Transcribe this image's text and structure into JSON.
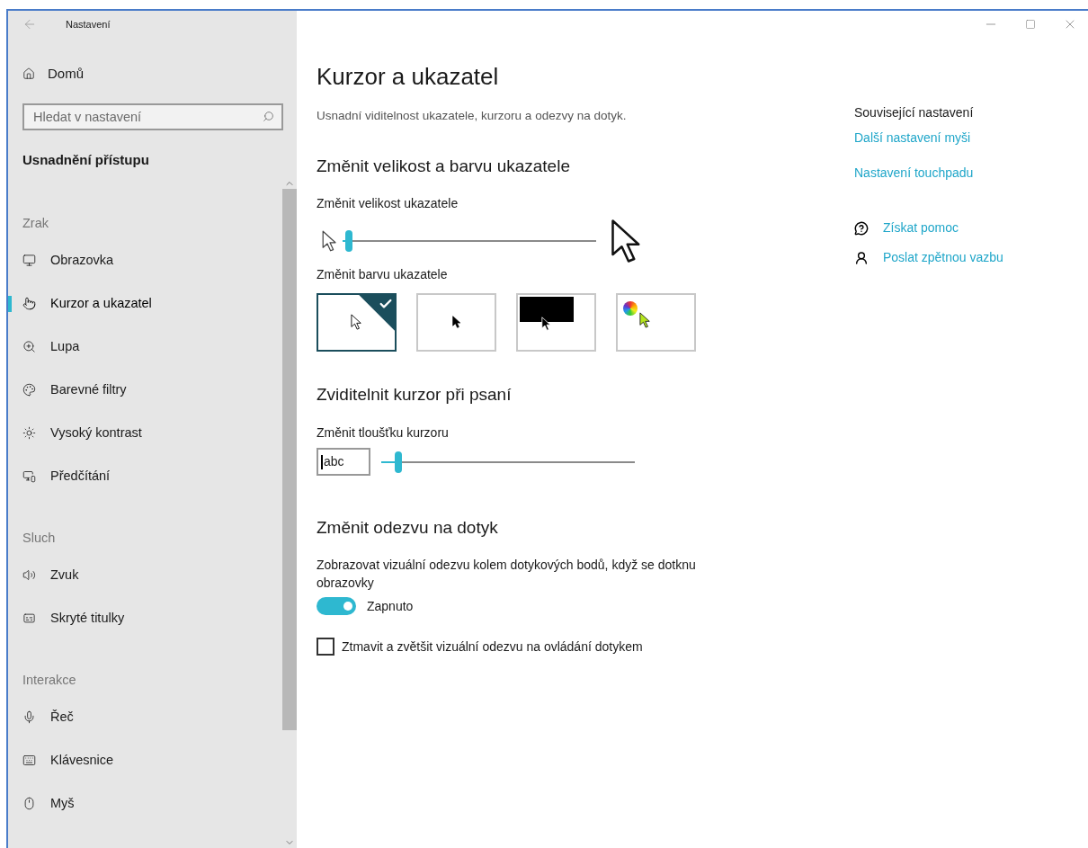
{
  "window": {
    "title": "Nastavení"
  },
  "sidebar": {
    "home": "Domů",
    "search": {
      "placeholder": "Hledat v nastavení"
    },
    "heading": "Usnadnění přístupu",
    "groups": [
      {
        "label": "Zrak",
        "items": [
          {
            "label": "Obrazovka",
            "selected": false
          },
          {
            "label": "Kurzor a ukazatel",
            "selected": true
          },
          {
            "label": "Lupa",
            "selected": false
          },
          {
            "label": "Barevné filtry",
            "selected": false
          },
          {
            "label": "Vysoký kontrast",
            "selected": false
          },
          {
            "label": "Předčítání",
            "selected": false
          }
        ]
      },
      {
        "label": "Sluch",
        "items": [
          {
            "label": "Zvuk",
            "selected": false
          },
          {
            "label": "Skryté titulky",
            "selected": false
          }
        ]
      },
      {
        "label": "Interakce",
        "items": [
          {
            "label": "Řeč",
            "selected": false
          },
          {
            "label": "Klávesnice",
            "selected": false
          },
          {
            "label": "Myš",
            "selected": false
          }
        ]
      }
    ]
  },
  "page": {
    "title": "Kurzor a ukazatel",
    "subtitle": "Usnadní viditelnost ukazatele, kurzoru a odezvy na dotyk.",
    "pointer_section": {
      "heading": "Změnit velikost a barvu ukazatele",
      "size_label": "Změnit velikost ukazatele",
      "size": {
        "level": 0.02
      },
      "color_label": "Změnit barvu ukazatele",
      "colors": [
        {
          "kind": "white",
          "selected": true
        },
        {
          "kind": "black",
          "selected": false
        },
        {
          "kind": "inverted",
          "selected": false
        },
        {
          "kind": "custom",
          "selected": false
        }
      ]
    },
    "cursor_section": {
      "heading": "Zviditelnit kurzor při psaní",
      "thickness_label": "Změnit tloušťku kurzoru",
      "preview": "abc",
      "thickness": {
        "level": 0.06
      }
    },
    "touch_section": {
      "heading": "Změnit odezvu na dotyk",
      "description": "Zobrazovat vizuální odezvu kolem dotykových bodů, když se dotknu obrazovky",
      "toggle": {
        "on": true,
        "label": "Zapnuto"
      },
      "checkbox": {
        "checked": false,
        "label": "Ztmavit a zvětšit vizuální odezvu na ovládání dotykem"
      }
    }
  },
  "related": {
    "heading": "Související nastavení",
    "links": [
      "Další nastavení myši",
      "Nastavení touchpadu"
    ],
    "help": [
      "Získat pomoc",
      "Poslat zpětnou vazbu"
    ]
  }
}
